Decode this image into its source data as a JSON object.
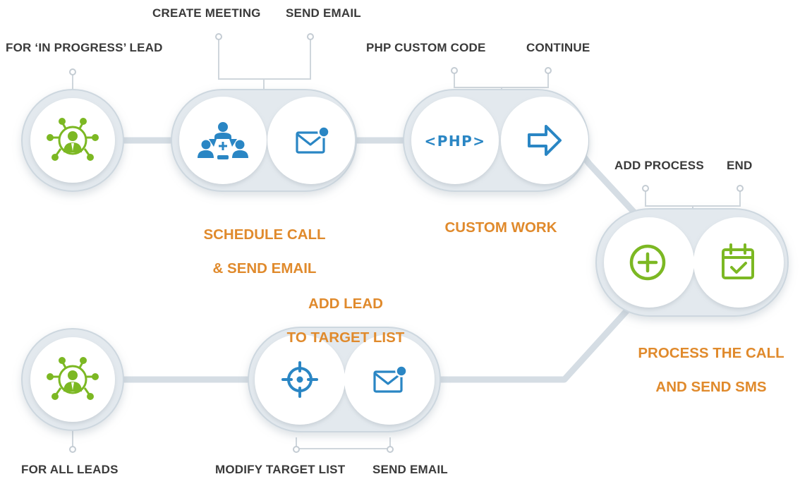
{
  "colors": {
    "connector": "#d5dde4",
    "pill_fill": "#e3e9ee",
    "pill_stroke": "#cdd7df",
    "circle_fill": "#ffffff",
    "blue": "#2a86c4",
    "green": "#7cb823",
    "title_orange": "#e08a2c",
    "label_dark": "#3a3a3a"
  },
  "nodes": {
    "in_progress_lead": {
      "icon": "network-user-icon",
      "caption": "FOR ‘IN PROGRESS’ LEAD"
    },
    "schedule_call": {
      "title_line1": "SCHEDULE CALL",
      "title_line2": "& SEND EMAIL",
      "actions": [
        {
          "icon": "meeting-group-icon",
          "caption": "CREATE MEETING"
        },
        {
          "icon": "email-icon",
          "caption": "SEND EMAIL"
        }
      ]
    },
    "custom_work": {
      "title": "CUSTOM WORK",
      "actions": [
        {
          "icon": "php-code-icon",
          "icon_text": "<PHP>",
          "caption": "PHP CUSTOM CODE"
        },
        {
          "icon": "arrow-right-icon",
          "caption": "CONTINUE"
        }
      ]
    },
    "process_call": {
      "title_line1": "PROCESS THE CALL",
      "title_line2": "AND SEND SMS",
      "actions": [
        {
          "icon": "plus-circle-icon",
          "caption": "ADD PROCESS"
        },
        {
          "icon": "calendar-check-icon",
          "caption": "END"
        }
      ]
    },
    "add_lead": {
      "title_line1": "ADD LEAD",
      "title_line2": "TO TARGET LIST",
      "actions": [
        {
          "icon": "target-icon",
          "caption": "MODIFY TARGET LIST"
        },
        {
          "icon": "email-icon",
          "caption": "SEND EMAIL"
        }
      ]
    },
    "all_leads": {
      "icon": "network-user-icon",
      "caption": "FOR ALL LEADS"
    }
  }
}
